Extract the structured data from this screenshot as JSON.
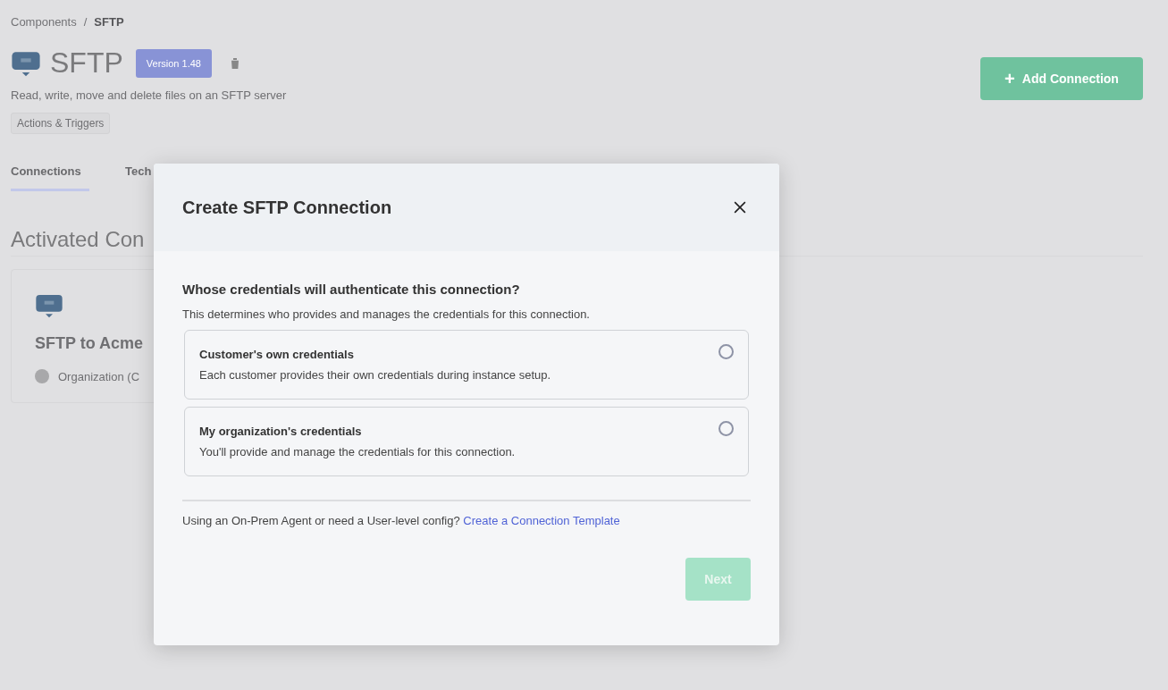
{
  "page": {
    "breadcrumb": [
      {
        "label": "Components",
        "current": false
      },
      {
        "label": "SFTP",
        "current": true
      }
    ],
    "title": "SFTP",
    "version_badge": "Version 1.48",
    "description": "Read, write, move and delete files on an SFTP server",
    "tag": "Actions & Triggers",
    "add_button": "Add Connection",
    "add_icon": "+",
    "breadcrumb_separator": "/",
    "tabs": [
      {
        "label": "Connections",
        "selected": true
      },
      {
        "label": "Tech",
        "selected": false
      }
    ],
    "section_title": "Activated Con",
    "card": {
      "name": "SFTP to Acme",
      "owner": "Organization (C"
    }
  },
  "dialog": {
    "title": "Create SFTP Connection",
    "question": "Whose credentials will authenticate this connection?",
    "hint": "This determines who provides and manages the credentials for this connection.",
    "options": [
      {
        "title": "Customer's own credentials",
        "description": "Each customer provides their own credentials during instance setup.",
        "selected": false
      },
      {
        "title": "My organization's credentials",
        "description": "You'll provide and manage the credentials for this connection.",
        "selected": false
      }
    ],
    "footer_text": "Using an On-Prem Agent or need a User-level config?",
    "footer_link": "Create a Connection Template",
    "next_button": {
      "label": "Next",
      "disabled": true
    }
  }
}
